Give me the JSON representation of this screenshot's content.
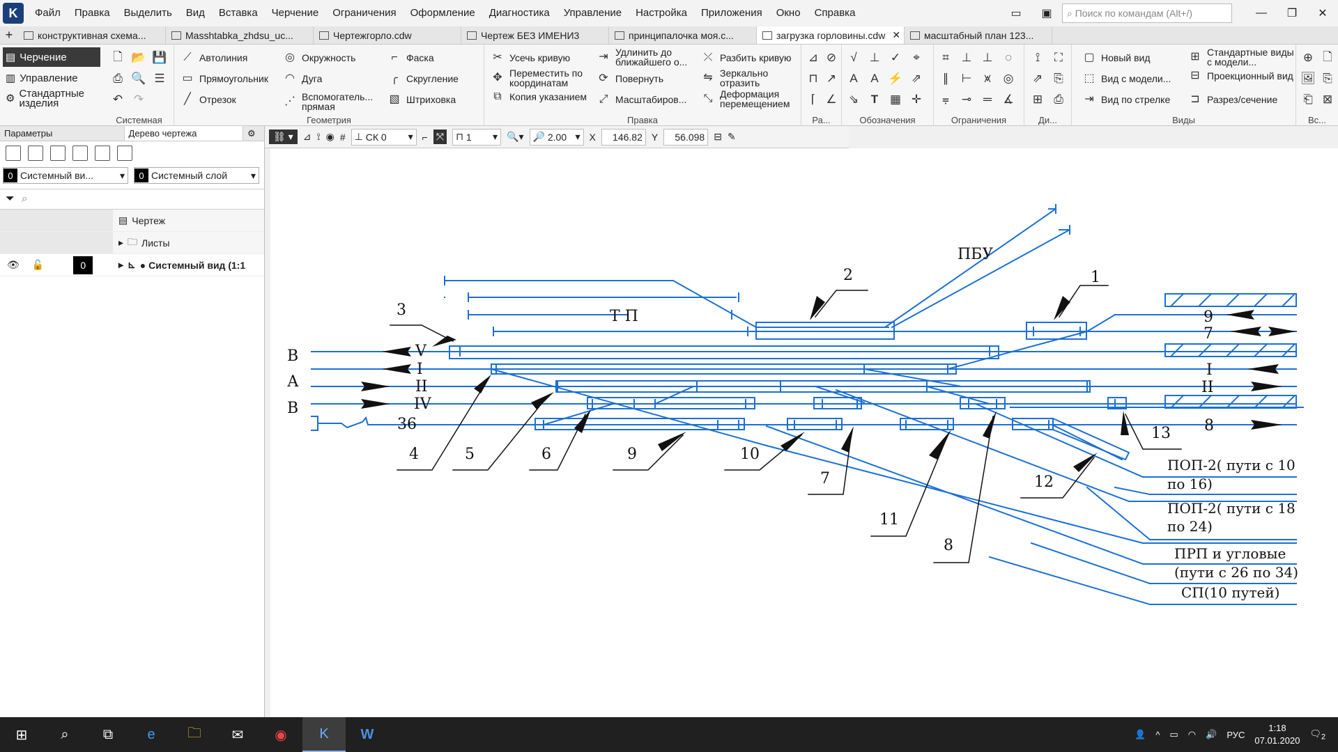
{
  "menu": [
    "Файл",
    "Правка",
    "Выделить",
    "Вид",
    "Вставка",
    "Черчение",
    "Ограничения",
    "Оформление",
    "Диагностика",
    "Управление",
    "Настройка",
    "Приложения",
    "Окно",
    "Справка"
  ],
  "search_placeholder": "Поиск по командам (Alt+/)",
  "tabs": [
    "конструктивная схема...",
    "Masshtabka_zhdsu_uc...",
    "Чертежгорло.cdw",
    "Чертеж БЕЗ ИМЕНИ3",
    "принципалочка моя.с...",
    "загрузка горловины.cdw",
    "масштабный план 123..."
  ],
  "modes": [
    "Черчение",
    "Управление",
    "Стандартные изделия"
  ],
  "groups": {
    "system": "Системная",
    "geometry": "Геометрия",
    "edit": "Правка",
    "ra": "Ра...",
    "marks": "Обозначения",
    "constraints": "Ограничения",
    "di": "Ди...",
    "views": "Виды",
    "vs": "Вс..."
  },
  "geometry": [
    "Автолиния",
    "Окружность",
    "Фаска",
    "Прямоугольник",
    "Дуга",
    "Скругление",
    "Отрезок",
    "Вспомогатель... прямая",
    "Штриховка"
  ],
  "edit": [
    "Усечь кривую",
    "Удлинить до ближайшего о...",
    "Разбить кривую",
    "Переместить по координатам",
    "Повернуть",
    "Зеркально отразить",
    "Копия указанием",
    "Масштабиров...",
    "Деформация перемещением"
  ],
  "views": [
    "Новый вид",
    "Стандартные виды с модели...",
    "Вид с модели...",
    "Проекционный вид",
    "Вид по стрелке",
    "Разрез/сечение"
  ],
  "panel_tabs": [
    "Параметры",
    "Дерево чертежа"
  ],
  "combo1": {
    "num": "0",
    "label": "Системный ви..."
  },
  "combo2": {
    "num": "0",
    "label": "Системный слой"
  },
  "tree": [
    "Чертеж",
    "Листы",
    "● Системный вид (1:1"
  ],
  "canvasbar": {
    "ck": "СК 0",
    "step": "1",
    "zoom": "2.00",
    "x_label": "X",
    "x": "146.82",
    "y_label": "Y",
    "y": "56.098"
  },
  "drawing": {
    "labels_left": [
      "В",
      "А",
      "В"
    ],
    "track_names": [
      "V",
      "I",
      "II",
      "IV",
      "36",
      "Т П",
      "ПБУ",
      "9",
      "7",
      "I",
      "II",
      "8"
    ],
    "callouts": [
      "1",
      "2",
      "3",
      "4",
      "5",
      "6",
      "7",
      "8",
      "9",
      "10",
      "11",
      "12",
      "13"
    ],
    "destinations": [
      "ПОП-2( пути с 10",
      "по 16)",
      "ПОП-2( пути с 18",
      "по 24)",
      "ПРП и угловые",
      "(пути с 26 по 34)",
      "СП(10 путей)"
    ]
  },
  "tray": {
    "lang": "РУС",
    "time": "1:18",
    "date": "07.01.2020",
    "notif": "2"
  }
}
